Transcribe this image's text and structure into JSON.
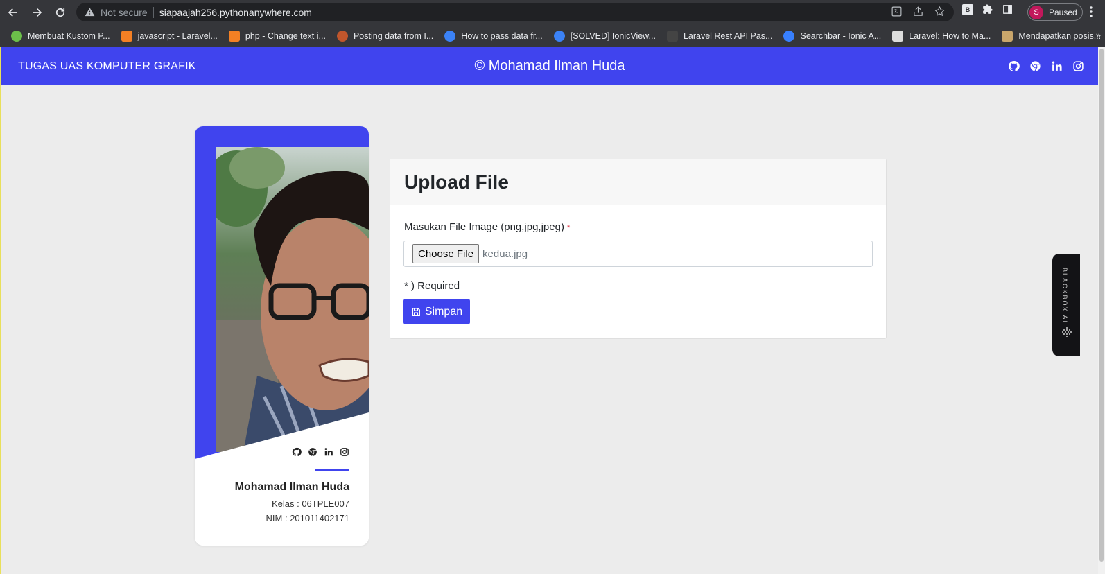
{
  "browser": {
    "not_secure": "Not secure",
    "url": "siapaajah256.pythonanywhere.com",
    "profile_initial": "S",
    "profile_status": "Paused",
    "extension_label": "B"
  },
  "bookmarks": [
    {
      "label": "Membuat Kustom P...",
      "color": "#6cc04a"
    },
    {
      "label": "javascript - Laravel...",
      "color": "#f48024"
    },
    {
      "label": "php - Change text i...",
      "color": "#f48024"
    },
    {
      "label": "Posting data from I...",
      "color": "#c0562c"
    },
    {
      "label": "How to pass data fr...",
      "color": "#3b82f6"
    },
    {
      "label": "[SOLVED] IonicView...",
      "color": "#3b82f6"
    },
    {
      "label": "Laravel Rest API Pas...",
      "color": "#444444"
    },
    {
      "label": "Searchbar - Ionic A...",
      "color": "#3880ff"
    },
    {
      "label": "Laravel: How to Ma...",
      "color": "#dddddd"
    },
    {
      "label": "Mendapatkan posis...",
      "color": "#c9a66b"
    }
  ],
  "bookmarks_more": "»",
  "navbar": {
    "brand": "TUGAS UAS KOMPUTER GRAFIK",
    "center": "© Mohamad Ilman Huda",
    "accent": "#4044ee"
  },
  "profile_card": {
    "name": "Mohamad Ilman Huda",
    "kelas": "Kelas : 06TPLE007",
    "nim": "NIM : 201011402171"
  },
  "upload": {
    "title": "Upload File",
    "field_label": "Masukan File Image (png,jpg,jpeg)",
    "required_mark": "*",
    "choose_button": "Choose File",
    "file_name": "kedua.jpg",
    "required_note": "* ) Required",
    "save_button": "Simpan"
  },
  "side_tab": {
    "label": "BLACKBOX AI"
  }
}
